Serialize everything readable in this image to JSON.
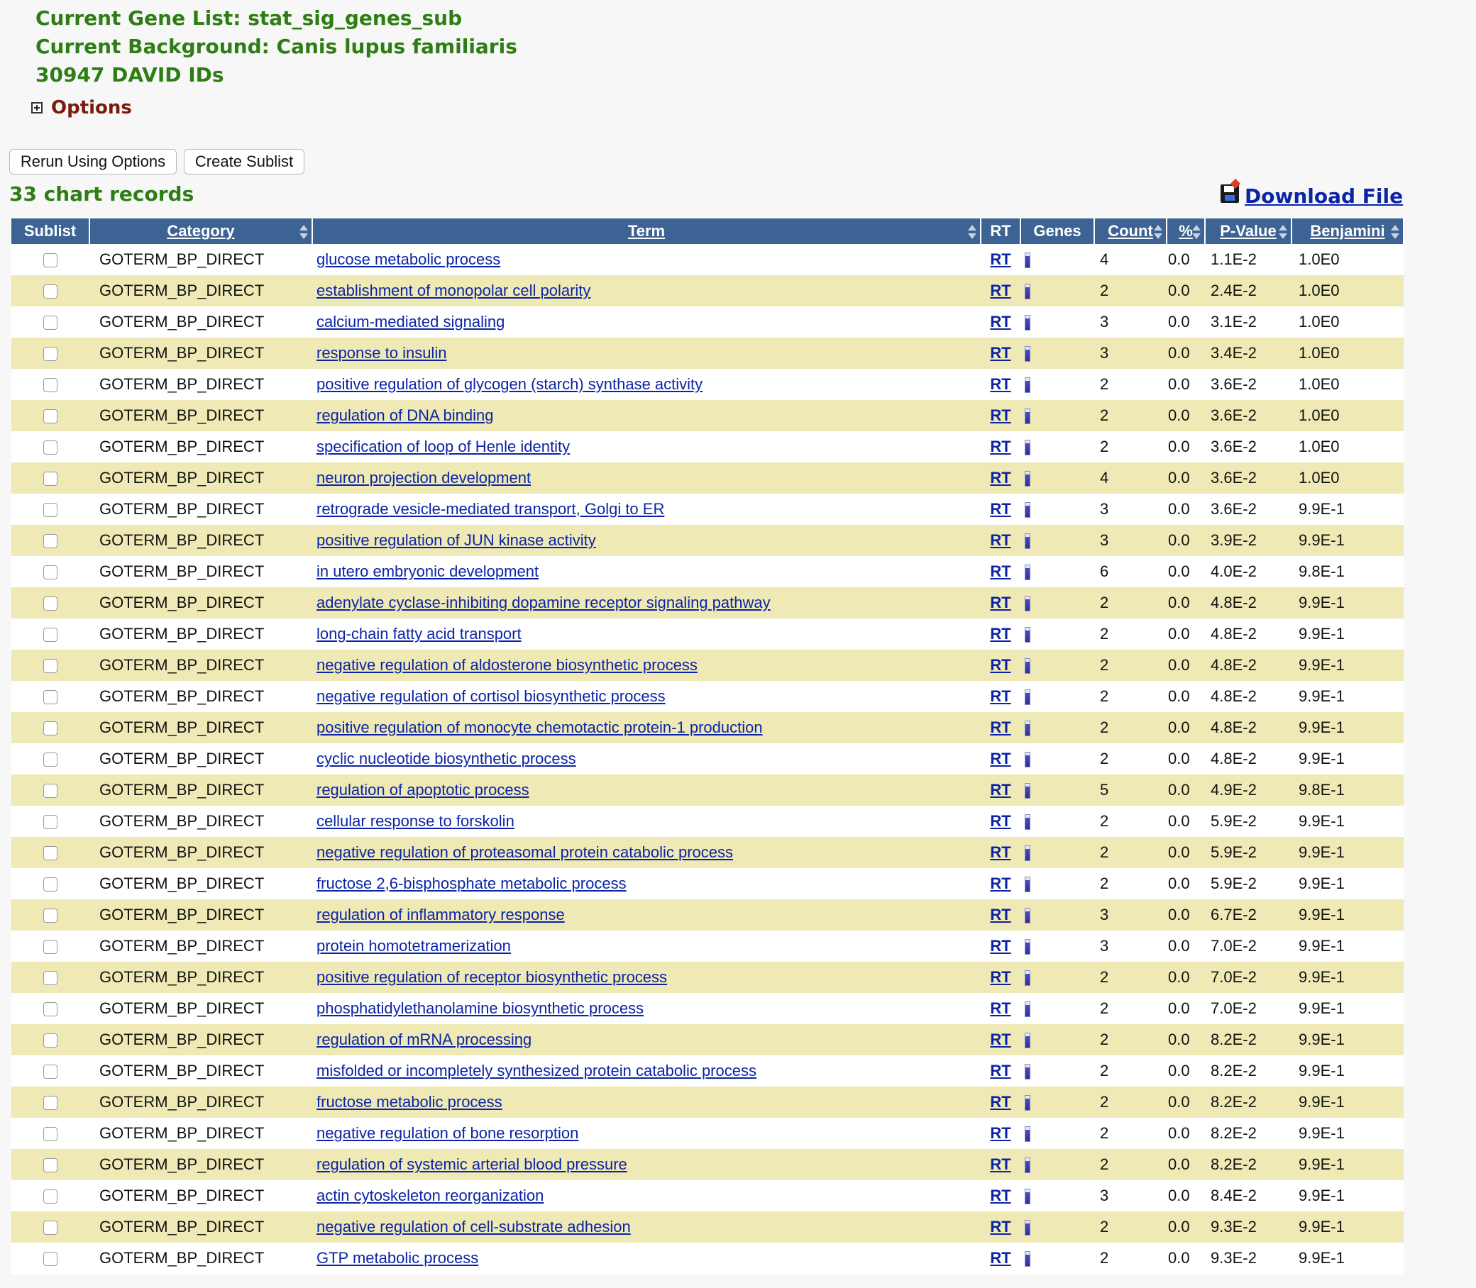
{
  "header": {
    "gene_list": "Current Gene List: stat_sig_genes_sub",
    "background": "Current Background: Canis lupus familiaris",
    "ids": "30947 DAVID IDs",
    "options_label": "Options"
  },
  "buttons": {
    "rerun": "Rerun Using Options",
    "create_sublist": "Create Sublist"
  },
  "records_label": "33 chart records",
  "download_label": "Download File",
  "table": {
    "columns": {
      "sublist": "Sublist",
      "category": "Category",
      "term": "Term",
      "rt": "RT",
      "genes": "Genes",
      "count": "Count",
      "percent": "%",
      "pvalue": "P-Value",
      "benjamini": "Benjamini"
    },
    "rows": [
      {
        "category": "GOTERM_BP_DIRECT",
        "term": "glucose metabolic process",
        "rt": "RT",
        "count": "4",
        "percent": "0.0",
        "pvalue": "1.1E-2",
        "benjamini": "1.0E0"
      },
      {
        "category": "GOTERM_BP_DIRECT",
        "term": "establishment of monopolar cell polarity",
        "rt": "RT",
        "count": "2",
        "percent": "0.0",
        "pvalue": "2.4E-2",
        "benjamini": "1.0E0"
      },
      {
        "category": "GOTERM_BP_DIRECT",
        "term": "calcium-mediated signaling",
        "rt": "RT",
        "count": "3",
        "percent": "0.0",
        "pvalue": "3.1E-2",
        "benjamini": "1.0E0"
      },
      {
        "category": "GOTERM_BP_DIRECT",
        "term": "response to insulin",
        "rt": "RT",
        "count": "3",
        "percent": "0.0",
        "pvalue": "3.4E-2",
        "benjamini": "1.0E0"
      },
      {
        "category": "GOTERM_BP_DIRECT",
        "term": "positive regulation of glycogen (starch) synthase activity",
        "rt": "RT",
        "count": "2",
        "percent": "0.0",
        "pvalue": "3.6E-2",
        "benjamini": "1.0E0"
      },
      {
        "category": "GOTERM_BP_DIRECT",
        "term": "regulation of DNA binding",
        "rt": "RT",
        "count": "2",
        "percent": "0.0",
        "pvalue": "3.6E-2",
        "benjamini": "1.0E0"
      },
      {
        "category": "GOTERM_BP_DIRECT",
        "term": "specification of loop of Henle identity",
        "rt": "RT",
        "count": "2",
        "percent": "0.0",
        "pvalue": "3.6E-2",
        "benjamini": "1.0E0"
      },
      {
        "category": "GOTERM_BP_DIRECT",
        "term": "neuron projection development",
        "rt": "RT",
        "count": "4",
        "percent": "0.0",
        "pvalue": "3.6E-2",
        "benjamini": "1.0E0"
      },
      {
        "category": "GOTERM_BP_DIRECT",
        "term": "retrograde vesicle-mediated transport, Golgi to ER",
        "rt": "RT",
        "count": "3",
        "percent": "0.0",
        "pvalue": "3.6E-2",
        "benjamini": "9.9E-1"
      },
      {
        "category": "GOTERM_BP_DIRECT",
        "term": "positive regulation of JUN kinase activity",
        "rt": "RT",
        "count": "3",
        "percent": "0.0",
        "pvalue": "3.9E-2",
        "benjamini": "9.9E-1"
      },
      {
        "category": "GOTERM_BP_DIRECT",
        "term": "in utero embryonic development",
        "rt": "RT",
        "count": "6",
        "percent": "0.0",
        "pvalue": "4.0E-2",
        "benjamini": "9.8E-1"
      },
      {
        "category": "GOTERM_BP_DIRECT",
        "term": "adenylate cyclase-inhibiting dopamine receptor signaling pathway",
        "rt": "RT",
        "count": "2",
        "percent": "0.0",
        "pvalue": "4.8E-2",
        "benjamini": "9.9E-1"
      },
      {
        "category": "GOTERM_BP_DIRECT",
        "term": "long-chain fatty acid transport",
        "rt": "RT",
        "count": "2",
        "percent": "0.0",
        "pvalue": "4.8E-2",
        "benjamini": "9.9E-1"
      },
      {
        "category": "GOTERM_BP_DIRECT",
        "term": "negative regulation of aldosterone biosynthetic process",
        "rt": "RT",
        "count": "2",
        "percent": "0.0",
        "pvalue": "4.8E-2",
        "benjamini": "9.9E-1"
      },
      {
        "category": "GOTERM_BP_DIRECT",
        "term": "negative regulation of cortisol biosynthetic process",
        "rt": "RT",
        "count": "2",
        "percent": "0.0",
        "pvalue": "4.8E-2",
        "benjamini": "9.9E-1"
      },
      {
        "category": "GOTERM_BP_DIRECT",
        "term": "positive regulation of monocyte chemotactic protein-1 production",
        "rt": "RT",
        "count": "2",
        "percent": "0.0",
        "pvalue": "4.8E-2",
        "benjamini": "9.9E-1"
      },
      {
        "category": "GOTERM_BP_DIRECT",
        "term": "cyclic nucleotide biosynthetic process",
        "rt": "RT",
        "count": "2",
        "percent": "0.0",
        "pvalue": "4.8E-2",
        "benjamini": "9.9E-1"
      },
      {
        "category": "GOTERM_BP_DIRECT",
        "term": "regulation of apoptotic process",
        "rt": "RT",
        "count": "5",
        "percent": "0.0",
        "pvalue": "4.9E-2",
        "benjamini": "9.8E-1"
      },
      {
        "category": "GOTERM_BP_DIRECT",
        "term": "cellular response to forskolin",
        "rt": "RT",
        "count": "2",
        "percent": "0.0",
        "pvalue": "5.9E-2",
        "benjamini": "9.9E-1"
      },
      {
        "category": "GOTERM_BP_DIRECT",
        "term": "negative regulation of proteasomal protein catabolic process",
        "rt": "RT",
        "count": "2",
        "percent": "0.0",
        "pvalue": "5.9E-2",
        "benjamini": "9.9E-1"
      },
      {
        "category": "GOTERM_BP_DIRECT",
        "term": "fructose 2,6-bisphosphate metabolic process",
        "rt": "RT",
        "count": "2",
        "percent": "0.0",
        "pvalue": "5.9E-2",
        "benjamini": "9.9E-1"
      },
      {
        "category": "GOTERM_BP_DIRECT",
        "term": "regulation of inflammatory response",
        "rt": "RT",
        "count": "3",
        "percent": "0.0",
        "pvalue": "6.7E-2",
        "benjamini": "9.9E-1"
      },
      {
        "category": "GOTERM_BP_DIRECT",
        "term": "protein homotetramerization",
        "rt": "RT",
        "count": "3",
        "percent": "0.0",
        "pvalue": "7.0E-2",
        "benjamini": "9.9E-1"
      },
      {
        "category": "GOTERM_BP_DIRECT",
        "term": "positive regulation of receptor biosynthetic process",
        "rt": "RT",
        "count": "2",
        "percent": "0.0",
        "pvalue": "7.0E-2",
        "benjamini": "9.9E-1"
      },
      {
        "category": "GOTERM_BP_DIRECT",
        "term": "phosphatidylethanolamine biosynthetic process",
        "rt": "RT",
        "count": "2",
        "percent": "0.0",
        "pvalue": "7.0E-2",
        "benjamini": "9.9E-1"
      },
      {
        "category": "GOTERM_BP_DIRECT",
        "term": "regulation of mRNA processing",
        "rt": "RT",
        "count": "2",
        "percent": "0.0",
        "pvalue": "8.2E-2",
        "benjamini": "9.9E-1"
      },
      {
        "category": "GOTERM_BP_DIRECT",
        "term": "misfolded or incompletely synthesized protein catabolic process",
        "rt": "RT",
        "count": "2",
        "percent": "0.0",
        "pvalue": "8.2E-2",
        "benjamini": "9.9E-1"
      },
      {
        "category": "GOTERM_BP_DIRECT",
        "term": "fructose metabolic process",
        "rt": "RT",
        "count": "2",
        "percent": "0.0",
        "pvalue": "8.2E-2",
        "benjamini": "9.9E-1"
      },
      {
        "category": "GOTERM_BP_DIRECT",
        "term": "negative regulation of bone resorption",
        "rt": "RT",
        "count": "2",
        "percent": "0.0",
        "pvalue": "8.2E-2",
        "benjamini": "9.9E-1"
      },
      {
        "category": "GOTERM_BP_DIRECT",
        "term": "regulation of systemic arterial blood pressure",
        "rt": "RT",
        "count": "2",
        "percent": "0.0",
        "pvalue": "8.2E-2",
        "benjamini": "9.9E-1"
      },
      {
        "category": "GOTERM_BP_DIRECT",
        "term": "actin cytoskeleton reorganization",
        "rt": "RT",
        "count": "3",
        "percent": "0.0",
        "pvalue": "8.4E-2",
        "benjamini": "9.9E-1"
      },
      {
        "category": "GOTERM_BP_DIRECT",
        "term": "negative regulation of cell-substrate adhesion",
        "rt": "RT",
        "count": "2",
        "percent": "0.0",
        "pvalue": "9.3E-2",
        "benjamini": "9.9E-1"
      },
      {
        "category": "GOTERM_BP_DIRECT",
        "term": "GTP metabolic process",
        "rt": "RT",
        "count": "2",
        "percent": "0.0",
        "pvalue": "9.3E-2",
        "benjamini": "9.9E-1"
      }
    ]
  }
}
